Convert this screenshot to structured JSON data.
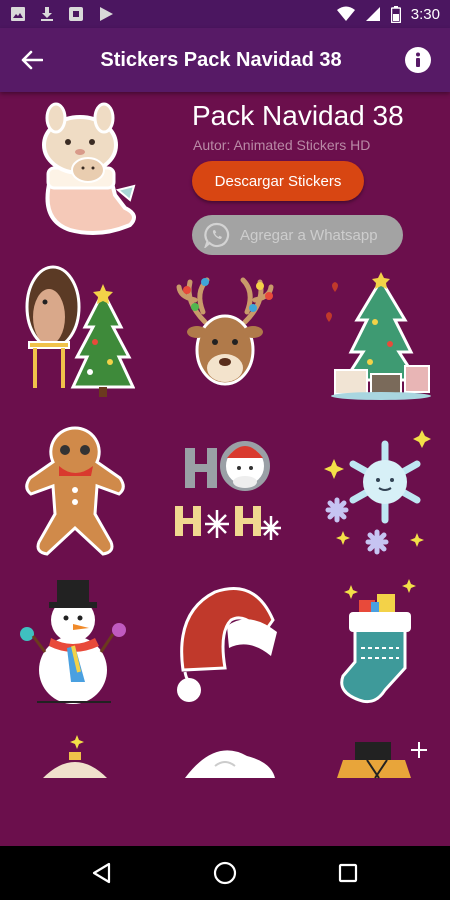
{
  "status_bar": {
    "time": "3:30",
    "icons": [
      "gallery-icon",
      "download-icon",
      "stop-icon",
      "play-icon",
      "wifi-icon",
      "signal-icon",
      "battery-icon"
    ]
  },
  "app_bar": {
    "title": "Stickers Pack Navidad 38",
    "back_icon": "arrow-left-icon",
    "info_icon": "info-icon"
  },
  "pack": {
    "name": "Pack Navidad 38",
    "author": "Autor: Animated Stickers HD",
    "download_label": "Descargar Stickers",
    "whatsapp_label": "Agregar a Whatsapp",
    "tray_sticker": "bunny-in-stocking"
  },
  "stickers": [
    {
      "id": "hedgehog-christmas-tree"
    },
    {
      "id": "reindeer-with-lights"
    },
    {
      "id": "christmas-tree-with-gifts"
    },
    {
      "id": "gingerbread-man"
    },
    {
      "id": "ho-ho-ho-santa"
    },
    {
      "id": "snowflakes"
    },
    {
      "id": "snowman-rainbow-scarf"
    },
    {
      "id": "santa-hat"
    },
    {
      "id": "christmas-stocking"
    },
    {
      "id": "sticker-partial-10"
    },
    {
      "id": "sticker-partial-11"
    },
    {
      "id": "sticker-partial-12"
    }
  ],
  "colors": {
    "background": "#6b0f4c",
    "app_bar": "#571a66",
    "download_button": "#d84612",
    "whatsapp_button_disabled": "#a3a3a3"
  },
  "nav_bar": {
    "icons": [
      "back-triangle-icon",
      "home-circle-icon",
      "recents-square-icon"
    ]
  }
}
